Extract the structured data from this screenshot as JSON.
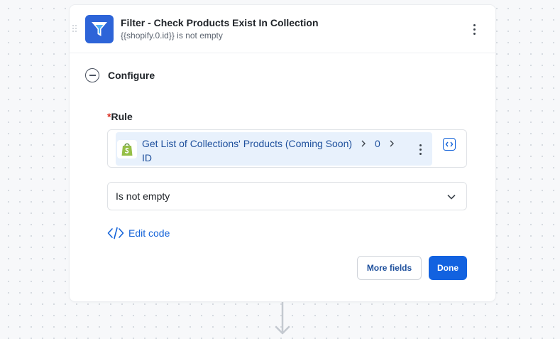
{
  "step": {
    "title": "Filter - Check Products Exist In Collection",
    "subtitle": "{{shopify.0.id}} is not empty"
  },
  "configure": {
    "section_title": "Configure",
    "rule": {
      "required_marker": "*",
      "label": "Rule",
      "chip": {
        "segments": [
          "Get List of Collections' Products (Coming Soon)",
          "0"
        ],
        "last_segment": "ID"
      }
    },
    "operator": {
      "selected": "Is not empty"
    },
    "edit_code_label": "Edit code",
    "actions": {
      "more_fields_label": "More fields",
      "done_label": "Done"
    }
  },
  "icons": {
    "app": "filter-funnel-icon",
    "collapse": "minus-circle-icon",
    "menu": "more-vertical-icon",
    "source": "shopify-bag-icon",
    "code_toggle": "code-brackets-icon",
    "dropdown": "chevron-down-icon",
    "edit_code": "code-icon",
    "connector": "arrow-down-icon"
  },
  "colors": {
    "accent": "#1262e0",
    "app_icon_bg": "#2d64d8",
    "chip_bg": "#e8f1fc",
    "chip_text": "#1d4f9c",
    "required": "#d92d20",
    "shopify_green": "#95bf47"
  }
}
